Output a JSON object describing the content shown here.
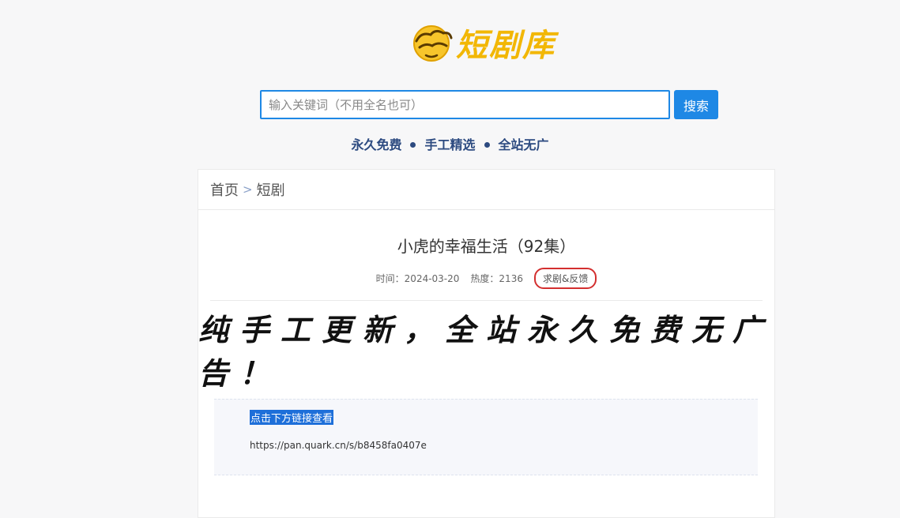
{
  "logo": {
    "icon": "cloud-emoji-icon",
    "text": "短剧库",
    "color": "#f2b705"
  },
  "search": {
    "placeholder": "输入关键词（不用全名也可）",
    "value": "",
    "button_label": "搜索",
    "accent": "#1e88e5"
  },
  "slogans": [
    "永久免费",
    "手工精选",
    "全站无广"
  ],
  "breadcrumb": {
    "home": "首页",
    "separator": ">",
    "current": "短剧"
  },
  "post": {
    "title": "小虎的幸福生活（92集）",
    "time_label": "时间：2024-03-20",
    "heat_label": "热度：2136",
    "feedback_label": "求剧&反馈",
    "banner_text": "纯手工更新，全站永久免费无广告！",
    "link_label": "点击下方链接查看",
    "link_url": "https://pan.quark.cn/s/b8458fa0407e"
  }
}
